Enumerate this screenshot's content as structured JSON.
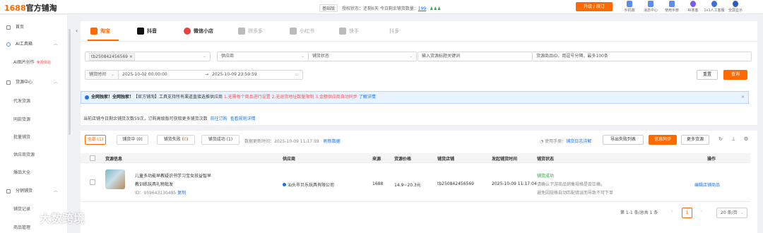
{
  "app": {
    "logo_prefix": "1688",
    "logo_suffix": "官方铺淘",
    "trial_badge": "基础版",
    "auth_status": "授权状态：还剩6天 今日剩余铺货数量：",
    "remaining_count": "199",
    "upgrade_label": "升级 / 续订",
    "top_icons": [
      {
        "label": "手机端",
        "icon": "phone-icon"
      },
      {
        "label": "消息中心",
        "icon": "bell-icon"
      },
      {
        "label": "使用手册",
        "icon": "book-icon"
      },
      {
        "label": "AI答客",
        "icon": "ai-icon"
      },
      {
        "label": "1v1人工客服",
        "icon": "headset-icon"
      },
      {
        "label": "全屏显示",
        "icon": "fullscreen-icon"
      }
    ]
  },
  "sidebar": {
    "items": [
      {
        "label": "首页",
        "type": "top"
      },
      {
        "label": "AI工具箱",
        "type": "group"
      },
      {
        "label": "AI图片创作",
        "type": "sub",
        "badge": "免费体验"
      },
      {
        "label": "货源中心",
        "type": "group"
      },
      {
        "label": "代发货源",
        "type": "sub"
      },
      {
        "label": "同款货源",
        "type": "sub"
      },
      {
        "label": "批量铺货",
        "type": "sub"
      },
      {
        "label": "供应商货源",
        "type": "sub"
      },
      {
        "label": "爆品大全",
        "type": "sub"
      },
      {
        "label": "分销铺货",
        "type": "group"
      },
      {
        "label": "铺货记录",
        "type": "sub"
      },
      {
        "label": "商品管理",
        "type": "sub"
      }
    ]
  },
  "platform_tabs": [
    {
      "label": "淘宝",
      "active": true,
      "color": "#ff6a00"
    },
    {
      "label": "抖音",
      "active": false,
      "color": "#111111"
    },
    {
      "label": "微信小店",
      "active": false,
      "color": "#e64340"
    },
    {
      "label": "拼多多",
      "active": false,
      "color": "#999999"
    },
    {
      "label": "小红书",
      "active": false,
      "color": "#999999"
    },
    {
      "label": "快手",
      "active": false,
      "color": "#999999"
    },
    {
      "label": "抖多",
      "active": false,
      "color": "#999999"
    }
  ],
  "filters": {
    "store_chip": "tb250842456569",
    "supplier_placeholder": "供应商",
    "status_placeholder": "铺货状态",
    "keyword_placeholder": "输入货源标题关键词",
    "ids_placeholder": "货源商品ID，用逗号分隔，最多100条",
    "time_type": "铺货时间",
    "start_time": "2025-10-02 00:00:00",
    "end_time": "2025-10-09 23:59:59",
    "reset_label": "重置",
    "search_label": "查询"
  },
  "notice": {
    "bold": "全网独家！全网独家！",
    "text": "【官方铺淘】工具支持所有渠道直接选推供应商 ",
    "red": "1.无需每个商品进行设置 2.无退货地址数量限制 3.金额供应商自动同步 ",
    "link": "了解详情"
  },
  "quota": {
    "text": "当前店铺今日剩余铺货次数59次，订购高级版可获取更多铺货次数",
    "link1": "前往订购",
    "link2": "查看规则详情"
  },
  "status_tabs": [
    {
      "label": "全部",
      "count": "1"
    },
    {
      "label": "铺货中",
      "count": "0"
    },
    {
      "label": "铺货失败",
      "count": "0"
    },
    {
      "label": "铺货成功",
      "count": "1"
    }
  ],
  "data_update": {
    "text": "数据更新时间：2025-10-09 11:17:59",
    "refresh": "刷新数据"
  },
  "actions": {
    "help_prefix": "使用手册：",
    "help_link": "铺货日志详解",
    "export_failed": "导出失败列表",
    "sync": "信息同步",
    "more": "更多货源"
  },
  "table": {
    "headers": [
      "货源信息",
      "供应商",
      "来源",
      "货源价格",
      "铺货店铺",
      "发起铺货时间",
      "铺货状态",
      "操作"
    ],
    "rows": [
      {
        "title_line1": "儿童多功能早教疑识书学习宝女孩益智早",
        "title_line2": "教训练玩具礼物批发",
        "id_label": "ID：959643130485",
        "copy": "复制",
        "supplier": "汕头市贝乐玩具有限公司",
        "source": "1688",
        "price": "14.9~20.3元",
        "store": "tb250842456569",
        "time": "2025-10-09 11:17:04",
        "status": "铺货成功",
        "status_note1": "请确认下游商品销售规格是否正确，",
        "status_note2": "避免因规格自动匹配错误而导致不可下单",
        "op": "编辑店铺商品"
      }
    ]
  },
  "pagination": {
    "summary": "第 1-1 条/总共 1 条",
    "current": "1",
    "page_size": "20 条/页"
  },
  "watermark": "大数跨境"
}
